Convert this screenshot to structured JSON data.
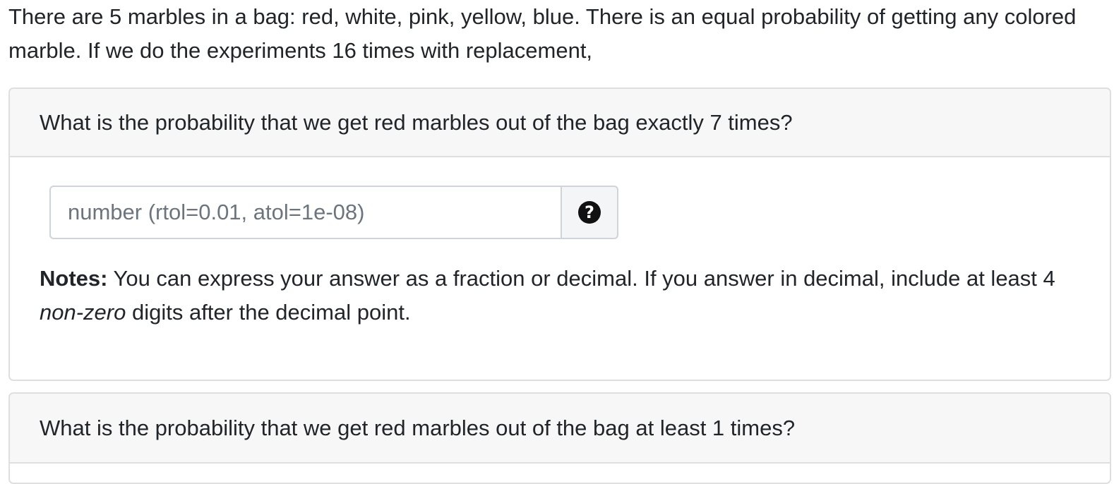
{
  "intro": {
    "text": "There are 5 marbles in a bag: red, white, pink, yellow, blue. There is an equal probability of getting any colored marble. If we do the experiments 16 times with replacement,"
  },
  "questions": [
    {
      "prompt": "What is the probability that we get red marbles out of the bag exactly 7 times?",
      "input_placeholder": "number (rtol=0.01, atol=1e-08)",
      "input_value": "",
      "help_icon": "question-circle-icon",
      "notes_label": "Notes:",
      "notes_text_1": " You can express your answer as a fraction or decimal. If you answer in decimal, include at least 4 ",
      "notes_emphasis": "non-zero",
      "notes_text_2": " digits after the decimal point."
    },
    {
      "prompt": "What is the probability that we get red marbles out of the bag at least 1 times?"
    }
  ]
}
